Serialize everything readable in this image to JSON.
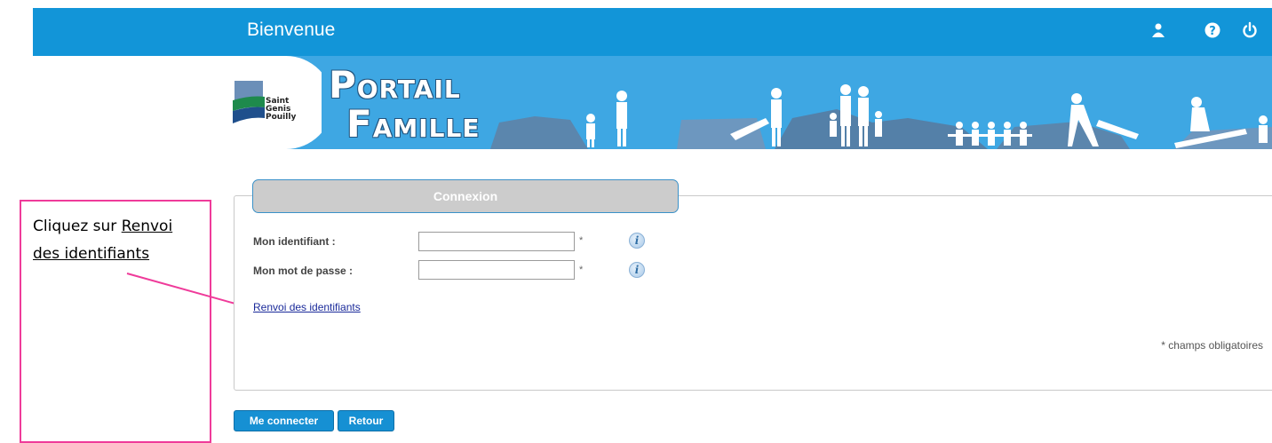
{
  "header": {
    "title": "Bienvenue",
    "icons": [
      "user-icon",
      "help-icon",
      "power-icon"
    ],
    "background_color": "#1295d8"
  },
  "banner": {
    "logo_text": [
      "Saint",
      "Genis",
      "Pouilly"
    ],
    "brand_line1_cap": "P",
    "brand_line1_rest": "ORTAIL",
    "brand_line2_cap": "F",
    "brand_line2_rest": "AMILLE"
  },
  "callout": {
    "prefix": "Cliquez sur ",
    "link_text": "Renvoi des identifiants",
    "border_color": "#ef3b9a"
  },
  "login": {
    "panel_title": "Connexion",
    "identifier_label": "Mon identifiant :",
    "identifier_value": "",
    "password_label": "Mon mot de passe :",
    "password_value": "",
    "required_marker": "*",
    "forgot_link": "Renvoi des identifiants",
    "required_note": "* champs obligatoires"
  },
  "actions": {
    "connect_label": "Me connecter",
    "back_label": "Retour"
  }
}
